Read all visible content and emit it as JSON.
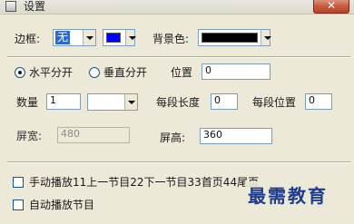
{
  "window": {
    "title": "设置",
    "close_glyph": "✕"
  },
  "border": {
    "label": "边框:",
    "style_value": "无",
    "color_hex": "#0000ff"
  },
  "background": {
    "label": "背景色:",
    "color_hex": "#000000"
  },
  "split": {
    "horizontal_label": "水平分开",
    "vertical_label": "垂直分开",
    "selected": "horizontal",
    "position_label": "位置",
    "position_value": "0"
  },
  "segments": {
    "count_label": "数量",
    "count_value": "1",
    "unit_value": "",
    "length_label": "每段长度",
    "length_value": "0",
    "offset_label": "每段位置",
    "offset_value": "0"
  },
  "screen": {
    "width_label": "屏宽:",
    "width_value": "480",
    "height_label": "屏高:",
    "height_value": "360"
  },
  "options": {
    "manual_label": "手动播放11上一节目22下一节目33首页44尾页",
    "auto_label": "自动播放节目"
  },
  "watermark_text": "最需教育"
}
